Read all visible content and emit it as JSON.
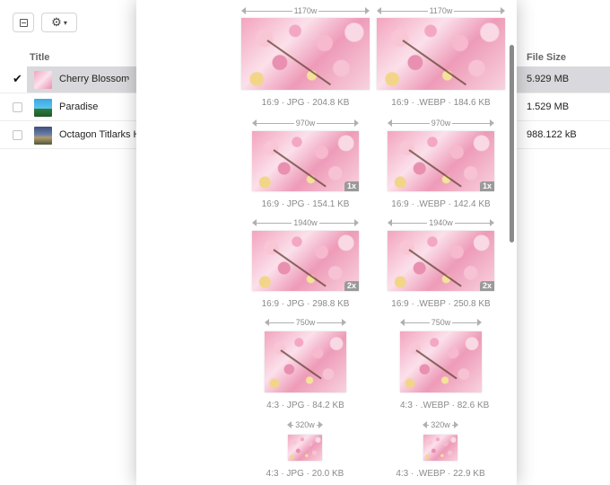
{
  "toolbar": {
    "gear_caret": "▾"
  },
  "table": {
    "title_header": "Title",
    "size_header": "File Size",
    "rows": [
      {
        "name": "Cherry Blossom",
        "size": "5.929 MB",
        "selected": true,
        "check": "✔"
      },
      {
        "name": "Paradise",
        "size": "1.529 MB",
        "selected": false
      },
      {
        "name": "Octagon Titlarks H",
        "size": "988.122 kB",
        "selected": false
      }
    ]
  },
  "variants": [
    {
      "width": "1170w",
      "caption": "16:9 · JPG · 204.8 KB",
      "badge": ""
    },
    {
      "width": "1170w",
      "caption": "16:9 · .WEBP · 184.6 KB",
      "badge": ""
    },
    {
      "width": "970w",
      "caption": "16:9 · JPG · 154.1 KB",
      "badge": "1x"
    },
    {
      "width": "970w",
      "caption": "16:9 · .WEBP · 142.4 KB",
      "badge": "1x"
    },
    {
      "width": "1940w",
      "caption": "16:9 · JPG · 298.8 KB",
      "badge": "2x"
    },
    {
      "width": "1940w",
      "caption": "16:9 · .WEBP · 250.8 KB",
      "badge": "2x"
    },
    {
      "width": "750w",
      "caption": "4:3 · JPG · 84.2 KB",
      "badge": ""
    },
    {
      "width": "750w",
      "caption": "4:3 · .WEBP · 82.6 KB",
      "badge": ""
    },
    {
      "width": "320w",
      "caption": "4:3 · JPG · 20.0 KB",
      "badge": ""
    },
    {
      "width": "320w",
      "caption": "4:3 · .WEBP · 22.9 KB",
      "badge": ""
    }
  ]
}
